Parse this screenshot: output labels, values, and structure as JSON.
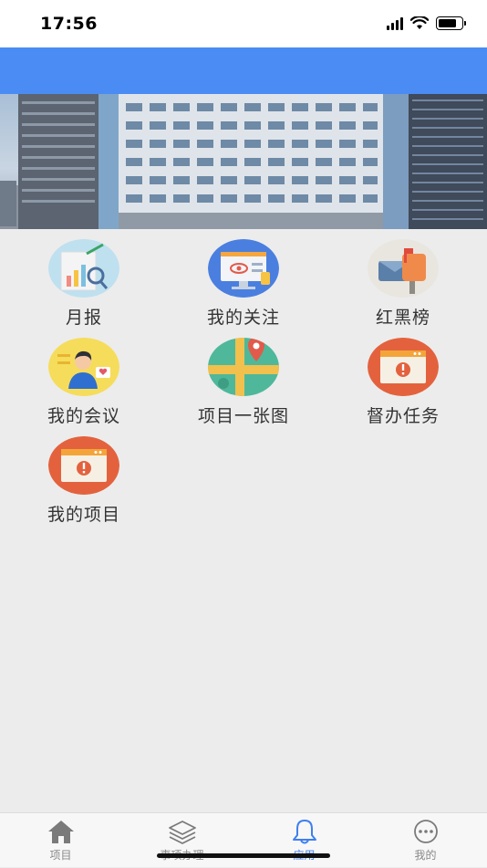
{
  "status_bar": {
    "time": "17:56"
  },
  "apps": [
    {
      "label": "月报",
      "icon": "monthly-report-icon"
    },
    {
      "label": "我的关注",
      "icon": "my-follow-icon"
    },
    {
      "label": "红黑榜",
      "icon": "red-black-list-icon"
    },
    {
      "label": "我的会议",
      "icon": "my-meeting-icon"
    },
    {
      "label": "项目一张图",
      "icon": "project-map-icon"
    },
    {
      "label": "督办任务",
      "icon": "supervision-task-icon"
    },
    {
      "label": "我的项目",
      "icon": "my-project-icon"
    }
  ],
  "tabbar": {
    "items": [
      {
        "label": "项目",
        "icon": "home-icon"
      },
      {
        "label": "事项办理",
        "icon": "layers-icon"
      },
      {
        "label": "应用",
        "icon": "bell-icon"
      },
      {
        "label": "我的",
        "icon": "more-icon"
      }
    ],
    "active_index": 2
  },
  "colors": {
    "header": "#4a8cf3",
    "accent": "#3f7ff0",
    "background": "#ececec"
  }
}
